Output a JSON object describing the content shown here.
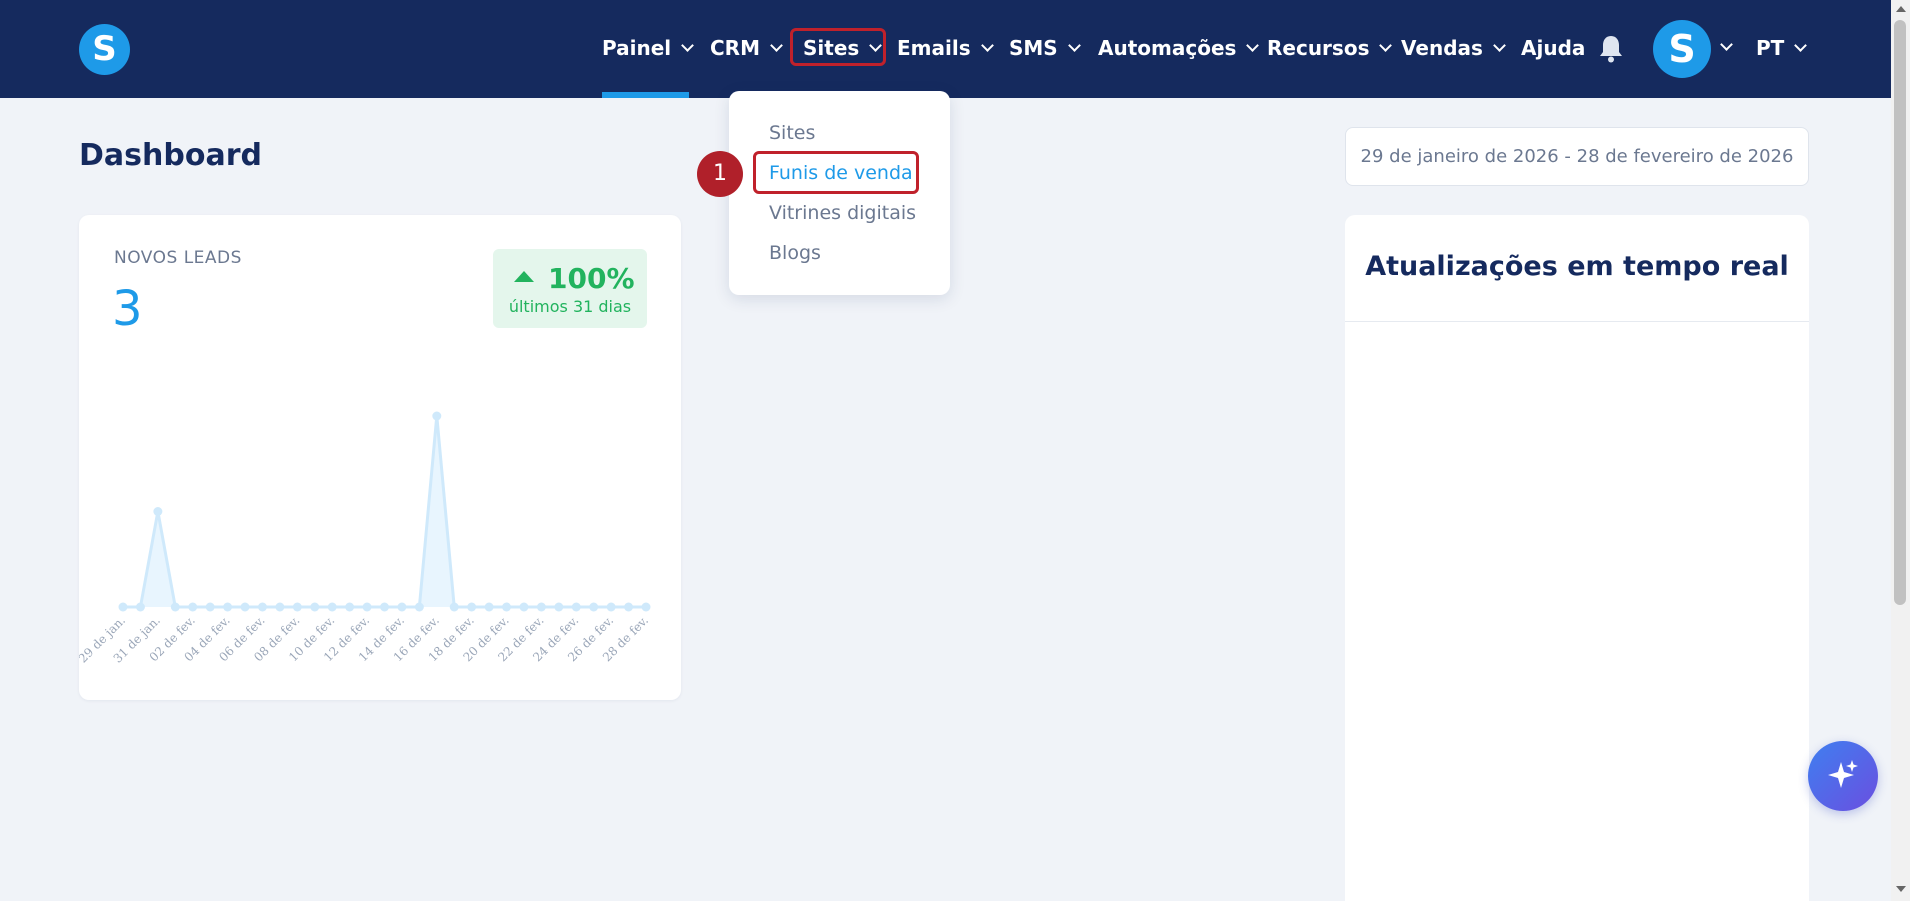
{
  "brand": {
    "logo_letter": "S",
    "accent": "#1e9ae8",
    "nav_bg": "#152a5e"
  },
  "nav": {
    "items": [
      {
        "label": "Painel",
        "has_dropdown": true
      },
      {
        "label": "CRM",
        "has_dropdown": true
      },
      {
        "label": "Sites",
        "has_dropdown": true
      },
      {
        "label": "Emails",
        "has_dropdown": true
      },
      {
        "label": "SMS",
        "has_dropdown": true
      },
      {
        "label": "Automações",
        "has_dropdown": true
      },
      {
        "label": "Recursos",
        "has_dropdown": true
      },
      {
        "label": "Vendas",
        "has_dropdown": true
      },
      {
        "label": "Ajuda",
        "has_dropdown": false
      }
    ],
    "bell_icon": "bell-icon",
    "avatar_letter": "S",
    "language": "PT"
  },
  "sites_menu": {
    "items": [
      {
        "label": "Sites"
      },
      {
        "label": "Funis de venda"
      },
      {
        "label": "Vitrines digitais"
      },
      {
        "label": "Blogs"
      }
    ],
    "step_number": "1"
  },
  "page": {
    "title": "Dashboard",
    "date_range": "29 de janeiro de 2026 - 28 de fevereiro de 2026"
  },
  "leads_card": {
    "label": "NOVOS LEADS",
    "value": "3",
    "change": "100%",
    "change_caption": "últimos 31 dias",
    "change_color": "#22b35e"
  },
  "realtime": {
    "title": "Atualizações em tempo real"
  },
  "chart_data": {
    "type": "area",
    "x": [
      "29 de jan.",
      "30 de jan.",
      "31 de jan.",
      "01 de fev.",
      "02 de fev.",
      "03 de fev.",
      "04 de fev.",
      "05 de fev.",
      "06 de fev.",
      "07 de fev.",
      "08 de fev.",
      "09 de fev.",
      "10 de fev.",
      "11 de fev.",
      "12 de fev.",
      "13 de fev.",
      "14 de fev.",
      "15 de fev.",
      "16 de fev.",
      "17 de fev.",
      "18 de fev.",
      "19 de fev.",
      "20 de fev.",
      "21 de fev.",
      "22 de fev.",
      "23 de fev.",
      "24 de fev.",
      "25 de fev.",
      "26 de fev.",
      "27 de fev.",
      "28 de fev."
    ],
    "tick_labels": [
      "29 de jan.",
      "31 de jan.",
      "02 de fev.",
      "04 de fev.",
      "06 de fev.",
      "08 de fev.",
      "10 de fev.",
      "12 de fev.",
      "14 de fev.",
      "16 de fev.",
      "18 de fev.",
      "20 de fev.",
      "22 de fev.",
      "24 de fev.",
      "26 de fev.",
      "28 de fev."
    ],
    "values": [
      0,
      0,
      1,
      0,
      0,
      0,
      0,
      0,
      0,
      0,
      0,
      0,
      0,
      0,
      0,
      0,
      0,
      0,
      2,
      0,
      0,
      0,
      0,
      0,
      0,
      0,
      0,
      0,
      0,
      0,
      0
    ],
    "ylim": [
      0,
      2
    ],
    "color": "#cfe9fb",
    "grid": false,
    "legend": "none"
  }
}
